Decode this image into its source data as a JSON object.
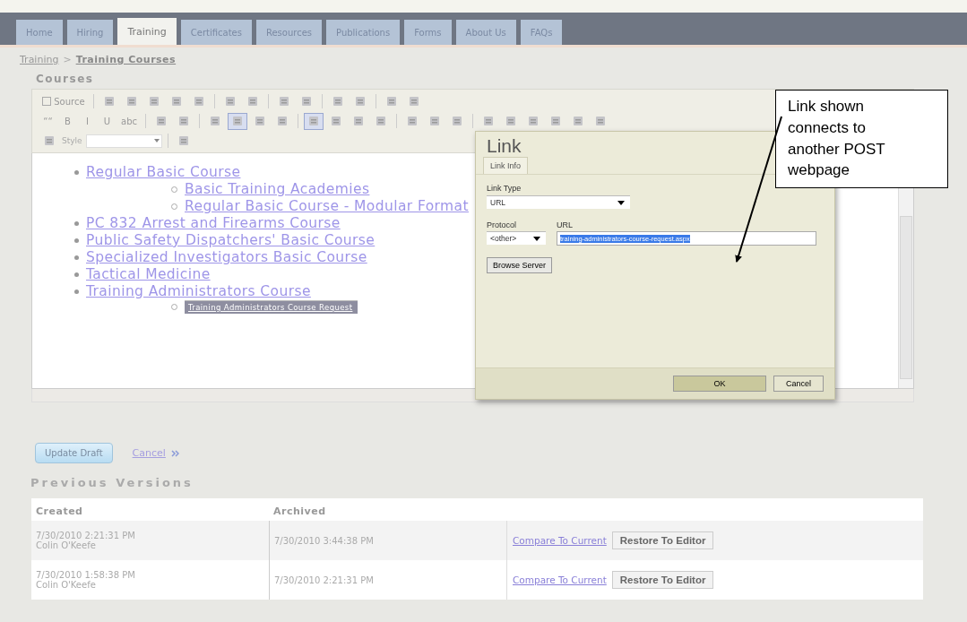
{
  "tabs": [
    {
      "label": "Home",
      "selected": false
    },
    {
      "label": "Hiring",
      "selected": false
    },
    {
      "label": "Training",
      "selected": true
    },
    {
      "label": "Certificates",
      "selected": false
    },
    {
      "label": "Resources",
      "selected": false
    },
    {
      "label": "Publications",
      "selected": false
    },
    {
      "label": "Forms",
      "selected": false
    },
    {
      "label": "About Us",
      "selected": false
    },
    {
      "label": "FAQs",
      "selected": false
    }
  ],
  "breadcrumb": [
    {
      "label": "Training",
      "kind": "link"
    },
    {
      "label": ">",
      "kind": "sep"
    },
    {
      "label": "Training Courses",
      "kind": "current"
    }
  ],
  "section_title": "Courses",
  "toolbar": [
    {
      "items": [
        {
          "kind": "text",
          "label": "Source",
          "selected": false
        },
        {
          "kind": "sep"
        },
        {
          "kind": "icon",
          "selected": false
        },
        {
          "kind": "icon",
          "selected": false
        },
        {
          "kind": "icon",
          "selected": false
        },
        {
          "kind": "icon",
          "selected": false
        },
        {
          "kind": "icon",
          "selected": false
        },
        {
          "kind": "sep"
        },
        {
          "kind": "icon",
          "selected": false
        },
        {
          "kind": "icon",
          "selected": false
        },
        {
          "kind": "sep"
        },
        {
          "kind": "icon",
          "selected": false
        },
        {
          "kind": "icon",
          "selected": false
        },
        {
          "kind": "sep"
        },
        {
          "kind": "icon",
          "selected": false
        },
        {
          "kind": "icon",
          "selected": false
        },
        {
          "kind": "sep"
        },
        {
          "kind": "icon",
          "selected": false
        },
        {
          "kind": "icon",
          "selected": false
        }
      ]
    },
    {
      "items": [
        {
          "kind": "glyph",
          "label": "““",
          "selected": false
        },
        {
          "kind": "glyph",
          "label": "B",
          "selected": false
        },
        {
          "kind": "glyph",
          "label": "I",
          "selected": false
        },
        {
          "kind": "glyph",
          "label": "U",
          "selected": false
        },
        {
          "kind": "glyph",
          "label": "abc",
          "selected": false
        },
        {
          "kind": "sep"
        },
        {
          "kind": "icon",
          "selected": false
        },
        {
          "kind": "icon",
          "selected": false
        },
        {
          "kind": "sep"
        },
        {
          "kind": "icon",
          "selected": false
        },
        {
          "kind": "icon",
          "selected": true
        },
        {
          "kind": "icon",
          "selected": false
        },
        {
          "kind": "icon",
          "selected": false
        },
        {
          "kind": "sep"
        },
        {
          "kind": "icon",
          "selected": true
        },
        {
          "kind": "icon",
          "selected": false
        },
        {
          "kind": "icon",
          "selected": false
        },
        {
          "kind": "icon",
          "selected": false
        },
        {
          "kind": "sep"
        },
        {
          "kind": "icon",
          "selected": false
        },
        {
          "kind": "icon",
          "selected": false
        },
        {
          "kind": "icon",
          "selected": false
        },
        {
          "kind": "sep"
        },
        {
          "kind": "icon",
          "selected": false
        },
        {
          "kind": "icon",
          "selected": false
        },
        {
          "kind": "icon",
          "selected": false
        },
        {
          "kind": "icon",
          "selected": false
        },
        {
          "kind": "icon",
          "selected": false
        },
        {
          "kind": "icon",
          "selected": false
        }
      ]
    },
    {
      "items": [
        {
          "kind": "icon",
          "selected": false
        },
        {
          "kind": "style",
          "label": "Style"
        },
        {
          "kind": "sep"
        },
        {
          "kind": "icon",
          "selected": false
        }
      ]
    }
  ],
  "courses": [
    {
      "label": "Regular Basic Course",
      "selected": false,
      "children": [
        {
          "label": "Basic Training Academies",
          "selected": false
        },
        {
          "label": "Regular Basic Course - Modular Format",
          "selected": false
        }
      ]
    },
    {
      "label": "PC 832 Arrest and Firearms Course",
      "selected": false
    },
    {
      "label": "Public Safety Dispatchers' Basic Course",
      "selected": false
    },
    {
      "label": "Specialized Investigators Basic Course",
      "selected": false
    },
    {
      "label": "Tactical Medicine",
      "selected": false
    },
    {
      "label": "Training Administrators Course",
      "selected": false,
      "children": [
        {
          "label": "Training Administrators Course Request",
          "selected": true
        }
      ]
    }
  ],
  "dialog": {
    "title": "Link",
    "tabs": [
      {
        "label": "Link Info",
        "selected": true
      }
    ],
    "link_type_label": "Link Type",
    "link_type": "URL",
    "protocol_label": "Protocol",
    "protocol": "<other>",
    "url_label": "URL",
    "url": "training-administrators-course-request.aspx",
    "browse_button": "Browse Server",
    "ok_button": "OK",
    "cancel_button": "Cancel"
  },
  "annotation": "Link shown connects to another POST webpage",
  "update_button": "Update Draft",
  "cancel_link": "Cancel",
  "versions": {
    "title": "Previous Versions",
    "columns": [
      "Created",
      "Archived"
    ],
    "rows": [
      {
        "created": "7/30/2010 2:21:31 PM",
        "author": "Colin O'Keefe",
        "archived": "7/30/2010 3:44:38 PM",
        "compare": "Compare To Current",
        "restore": "Restore To Editor"
      },
      {
        "created": "7/30/2010 1:58:38 PM",
        "author": "Colin O'Keefe",
        "archived": "7/30/2010 2:21:31 PM",
        "compare": "Compare To Current",
        "restore": "Restore To Editor"
      }
    ]
  }
}
